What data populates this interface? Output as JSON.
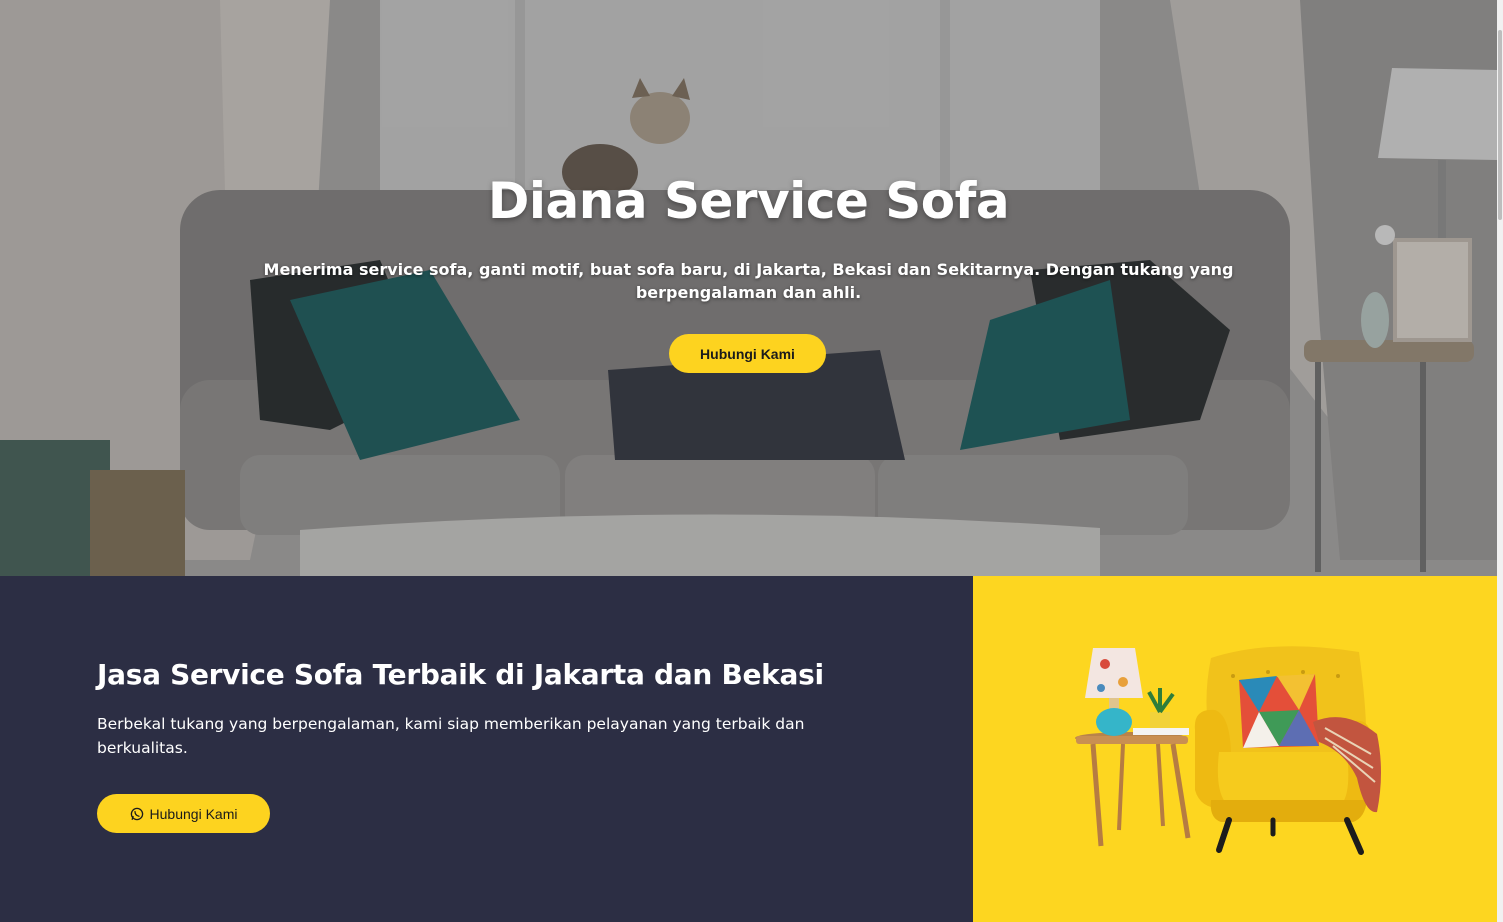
{
  "hero": {
    "title": "Diana Service Sofa",
    "subtitle": "Menerima service sofa, ganti motif, buat sofa baru, di Jakarta, Bekasi dan Sekitarnya. Dengan tukang yang berpengalaman dan ahli.",
    "button_label": "Hubungi Kami",
    "background_image": "living-room-sofa-photo"
  },
  "feature": {
    "title": "Jasa Service Sofa Terbaik di Jakarta dan Bekasi",
    "description": "Berbekal tukang yang berpengalaman, kami siap memberikan pelayanan yang terbaik dan berkualitas.",
    "button_label": "Hubungi Kami",
    "button_icon": "whatsapp-icon"
  },
  "product_panel": {
    "image": "yellow-armchair-with-side-table"
  },
  "colors": {
    "accent": "#fdd31f",
    "panel_yellow": "#fdd620",
    "navy": "#2c2e44"
  }
}
